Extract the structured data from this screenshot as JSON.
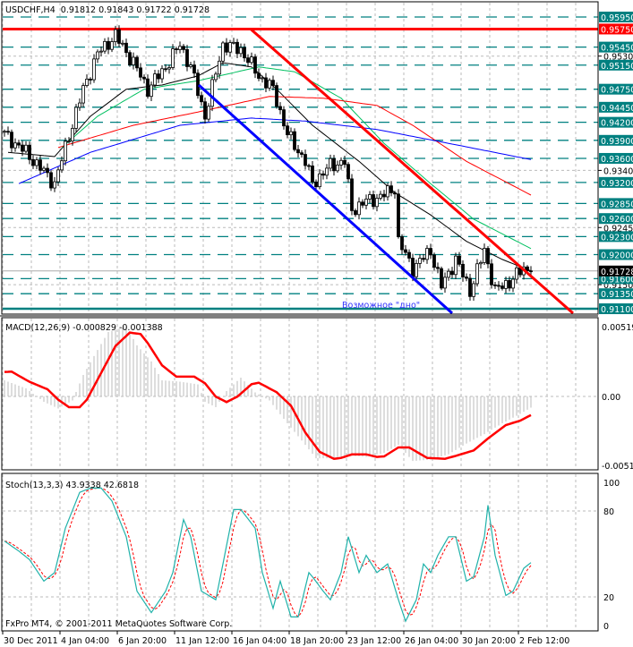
{
  "window": {
    "symbol_title": "USDCHF,H4  0.91812 0.91843 0.91722 0.91728",
    "copyright": "FxPro MT4, © 2001-2011 MetaQuotes Software Corp.",
    "annotation": "Возможное \"дно\""
  },
  "colors": {
    "teal": "#008080",
    "red": "#ff0000",
    "blue": "#0000ff",
    "green": "#00c060",
    "annotation": "#3333ff"
  },
  "chart_data": [
    {
      "type": "candlestick",
      "title": "USDCHF,H4",
      "ohlc_last": {
        "open": 0.91812,
        "high": 0.91843,
        "low": 0.91722,
        "close": 0.91728
      },
      "ylim": [
        0.9102,
        0.962
      ],
      "x_tick_labels": [
        "30 Dec 2011",
        "4 Jan 04:00",
        "6 Jan 20:00",
        "11 Jan 12:00",
        "16 Jan 04:00",
        "18 Jan 20:00",
        "23 Jan 12:00",
        "26 Jan 04:00",
        "30 Jan 20:00",
        "2 Feb 12:00"
      ],
      "x_tick_bars": [
        0,
        16,
        32,
        48,
        64,
        80,
        96,
        112,
        128,
        144
      ],
      "axis_ticks": [
        "0.95300",
        "0.93400",
        "0.92450",
        "0.91500"
      ],
      "level_lines": [
        {
          "label": "0.95950",
          "price": 0.9595,
          "style": "dash",
          "color": "teal"
        },
        {
          "label": "0.95750",
          "price": 0.9575,
          "style": "solid",
          "color": "red"
        },
        {
          "label": "0.95450",
          "price": 0.9545,
          "style": "dash",
          "color": "teal"
        },
        {
          "label": "0.95150",
          "price": 0.9515,
          "style": "dash",
          "color": "teal"
        },
        {
          "label": "0.94750",
          "price": 0.9475,
          "style": "dash",
          "color": "teal"
        },
        {
          "label": "0.94450",
          "price": 0.9445,
          "style": "dash",
          "color": "teal"
        },
        {
          "label": "0.94200",
          "price": 0.942,
          "style": "dash",
          "color": "teal"
        },
        {
          "label": "0.93900",
          "price": 0.939,
          "style": "dash",
          "color": "teal"
        },
        {
          "label": "0.93600",
          "price": 0.936,
          "style": "dash",
          "color": "teal"
        },
        {
          "label": "0.93200",
          "price": 0.932,
          "style": "dash",
          "color": "teal"
        },
        {
          "label": "0.92850",
          "price": 0.9285,
          "style": "dash",
          "color": "teal"
        },
        {
          "label": "0.92600",
          "price": 0.926,
          "style": "dash",
          "color": "teal"
        },
        {
          "label": "0.92300",
          "price": 0.923,
          "style": "dash",
          "color": "teal"
        },
        {
          "label": "0.92000",
          "price": 0.92,
          "style": "dash",
          "color": "teal"
        },
        {
          "label": "0.91600",
          "price": 0.916,
          "style": "dash",
          "color": "teal"
        },
        {
          "label": "0.91350",
          "price": 0.9135,
          "style": "dash",
          "color": "teal"
        },
        {
          "label": "0.91100",
          "price": 0.911,
          "style": "solid",
          "color": "teal"
        }
      ],
      "bid_label": "0.91728",
      "bid_price": 0.91728,
      "close_path": [
        [
          0,
          0.94
        ],
        [
          6,
          0.937
        ],
        [
          14,
          0.9318
        ],
        [
          17,
          0.9378
        ],
        [
          22,
          0.9475
        ],
        [
          26,
          0.9534
        ],
        [
          31,
          0.9564
        ],
        [
          36,
          0.9519
        ],
        [
          40,
          0.9475
        ],
        [
          45,
          0.9512
        ],
        [
          49,
          0.9549
        ],
        [
          52,
          0.9512
        ],
        [
          56,
          0.943
        ],
        [
          61,
          0.9549
        ],
        [
          66,
          0.9541
        ],
        [
          71,
          0.9497
        ],
        [
          75,
          0.9475
        ],
        [
          79,
          0.94
        ],
        [
          84,
          0.9355
        ],
        [
          86,
          0.9318
        ],
        [
          91,
          0.9348
        ],
        [
          95,
          0.9355
        ],
        [
          97,
          0.9274
        ],
        [
          101,
          0.9289
        ],
        [
          105,
          0.9296
        ],
        [
          109,
          0.9311
        ],
        [
          110,
          0.9222
        ],
        [
          114,
          0.9177
        ],
        [
          119,
          0.9207
        ],
        [
          122,
          0.9147
        ],
        [
          126,
          0.9192
        ],
        [
          130,
          0.914
        ],
        [
          134,
          0.9207
        ],
        [
          137,
          0.914
        ],
        [
          141,
          0.9155
        ],
        [
          145,
          0.9177
        ],
        [
          147,
          0.91728
        ]
      ],
      "moving_averages": [
        {
          "color": "black",
          "points": [
            [
              1,
              0.937
            ],
            [
              14,
              0.9363
            ],
            [
              24,
              0.943
            ],
            [
              34,
              0.9475
            ],
            [
              44,
              0.9482
            ],
            [
              54,
              0.9497
            ],
            [
              61,
              0.9519
            ],
            [
              69,
              0.9512
            ],
            [
              76,
              0.9475
            ],
            [
              86,
              0.9415
            ],
            [
              99,
              0.9355
            ],
            [
              109,
              0.9303
            ],
            [
              119,
              0.9266
            ],
            [
              129,
              0.9222
            ],
            [
              139,
              0.9192
            ],
            [
              147,
              0.9173
            ]
          ]
        },
        {
          "color": "green",
          "points": [
            [
              16,
              0.9378
            ],
            [
              26,
              0.943
            ],
            [
              39,
              0.9475
            ],
            [
              54,
              0.9489
            ],
            [
              71,
              0.9512
            ],
            [
              81,
              0.9504
            ],
            [
              94,
              0.946
            ],
            [
              106,
              0.9385
            ],
            [
              119,
              0.9318
            ],
            [
              131,
              0.9259
            ],
            [
              147,
              0.921
            ]
          ]
        },
        {
          "color": "red",
          "points": [
            [
              15,
              0.9378
            ],
            [
              36,
              0.9415
            ],
            [
              54,
              0.9437
            ],
            [
              74,
              0.9463
            ],
            [
              89,
              0.946
            ],
            [
              104,
              0.9448
            ],
            [
              114,
              0.9415
            ],
            [
              129,
              0.9355
            ],
            [
              147,
              0.9299
            ]
          ]
        },
        {
          "color": "blue",
          "points": [
            [
              4,
              0.9318
            ],
            [
              24,
              0.937
            ],
            [
              49,
              0.9415
            ],
            [
              69,
              0.9427
            ],
            [
              84,
              0.9422
            ],
            [
              104,
              0.9408
            ],
            [
              124,
              0.9385
            ],
            [
              147,
              0.9358
            ]
          ]
        }
      ],
      "trend_lines": [
        {
          "color": "red",
          "from": [
            68.75,
            0.9575
          ],
          "to": [
            158.75,
            0.91026
          ]
        },
        {
          "color": "blue",
          "from": [
            54.25,
            0.9482
          ],
          "to": [
            125,
            0.91026
          ]
        }
      ]
    },
    {
      "type": "macd",
      "label": "MACD(12,26,9) -0.000829 -0.001388",
      "ylim": [
        -0.00512,
        0.00519
      ],
      "tick_labels": [
        "0.00519",
        "0.00",
        "-0.00512"
      ],
      "main_milli": [
        [
          0,
          1.2
        ],
        [
          6,
          0.6
        ],
        [
          11,
          -0.4
        ],
        [
          15,
          -0.9
        ],
        [
          19,
          -0.3
        ],
        [
          22,
          1.6
        ],
        [
          25,
          3.0
        ],
        [
          29,
          4.8
        ],
        [
          34,
          5.2
        ],
        [
          37,
          3.8
        ],
        [
          41,
          2.6
        ],
        [
          44,
          1.2
        ],
        [
          49,
          1.1
        ],
        [
          54,
          0.9
        ],
        [
          56,
          -0.4
        ],
        [
          59,
          -0.8
        ],
        [
          62,
          0.4
        ],
        [
          66,
          1.4
        ],
        [
          70,
          0.3
        ],
        [
          74,
          -0.3
        ],
        [
          79,
          -2.0
        ],
        [
          84,
          -3.6
        ],
        [
          87,
          -4.6
        ],
        [
          91,
          -4.6
        ],
        [
          96,
          -4.4
        ],
        [
          101,
          -4.5
        ],
        [
          106,
          -4.2
        ],
        [
          110,
          -3.6
        ],
        [
          114,
          -4.8
        ],
        [
          119,
          -4.7
        ],
        [
          124,
          -4.3
        ],
        [
          129,
          -3.5
        ],
        [
          134,
          -2.8
        ],
        [
          139,
          -2.0
        ],
        [
          144,
          -1.3
        ],
        [
          147,
          -0.829
        ]
      ],
      "signal_milli": [
        [
          0,
          1.82
        ],
        [
          2,
          1.84
        ],
        [
          7,
          1.09
        ],
        [
          12,
          0.53
        ],
        [
          15,
          -0.24
        ],
        [
          18,
          -0.8
        ],
        [
          21,
          -0.8
        ],
        [
          23,
          -0.24
        ],
        [
          27,
          1.75
        ],
        [
          31,
          3.75
        ],
        [
          35,
          4.75
        ],
        [
          38,
          4.64
        ],
        [
          40,
          3.97
        ],
        [
          44,
          2.31
        ],
        [
          48,
          1.47
        ],
        [
          53,
          1.47
        ],
        [
          56,
          0.98
        ],
        [
          59,
          -0.02
        ],
        [
          62,
          -0.42
        ],
        [
          65,
          -0.02
        ],
        [
          69,
          0.91
        ],
        [
          71,
          1.02
        ],
        [
          76,
          0.31
        ],
        [
          80,
          -0.69
        ],
        [
          84,
          -2.68
        ],
        [
          88,
          -4.12
        ],
        [
          92,
          -4.64
        ],
        [
          94,
          -4.57
        ],
        [
          97,
          -4.31
        ],
        [
          101,
          -4.31
        ],
        [
          104,
          -4.5
        ],
        [
          106,
          -4.46
        ],
        [
          110,
          -3.79
        ],
        [
          113,
          -3.79
        ],
        [
          118,
          -4.57
        ],
        [
          123,
          -4.64
        ],
        [
          126,
          -4.42
        ],
        [
          131,
          -4.02
        ],
        [
          135,
          -3.13
        ],
        [
          140,
          -2.13
        ],
        [
          144,
          -1.8
        ],
        [
          147,
          -1.388
        ]
      ]
    },
    {
      "type": "stochastic",
      "label": "Stoch(13,3,3) 43.9338 42.6818",
      "ylim": [
        0,
        100
      ],
      "tick_labels": [
        "100",
        "80",
        "20",
        "0"
      ],
      "levels": [
        80,
        20
      ],
      "main": [
        [
          0,
          59
        ],
        [
          4,
          52
        ],
        [
          7,
          46
        ],
        [
          11,
          31
        ],
        [
          14,
          37
        ],
        [
          17,
          68
        ],
        [
          21,
          93
        ],
        [
          24,
          96
        ],
        [
          27,
          96
        ],
        [
          30,
          87
        ],
        [
          34,
          62
        ],
        [
          37,
          24
        ],
        [
          41,
          9
        ],
        [
          45,
          24
        ],
        [
          47,
          37
        ],
        [
          50,
          74
        ],
        [
          52,
          62
        ],
        [
          55,
          24
        ],
        [
          59,
          18
        ],
        [
          61,
          43
        ],
        [
          64,
          81
        ],
        [
          66,
          81
        ],
        [
          70,
          68
        ],
        [
          72,
          37
        ],
        [
          75,
          12
        ],
        [
          77,
          31
        ],
        [
          80,
          6
        ],
        [
          82,
          6
        ],
        [
          85,
          37
        ],
        [
          86,
          34
        ],
        [
          89,
          24
        ],
        [
          91,
          18
        ],
        [
          94,
          37
        ],
        [
          96,
          62
        ],
        [
          99,
          37
        ],
        [
          101,
          49
        ],
        [
          104,
          37
        ],
        [
          107,
          43
        ],
        [
          110,
          18
        ],
        [
          112,
          3
        ],
        [
          115,
          18
        ],
        [
          117,
          43
        ],
        [
          119,
          37
        ],
        [
          121,
          49
        ],
        [
          124,
          62
        ],
        [
          126,
          62
        ],
        [
          129,
          31
        ],
        [
          131,
          34
        ],
        [
          134,
          62
        ],
        [
          135,
          84
        ],
        [
          137,
          49
        ],
        [
          140,
          21
        ],
        [
          142,
          24
        ],
        [
          145,
          40
        ],
        [
          147,
          43.93
        ]
      ]
    }
  ]
}
